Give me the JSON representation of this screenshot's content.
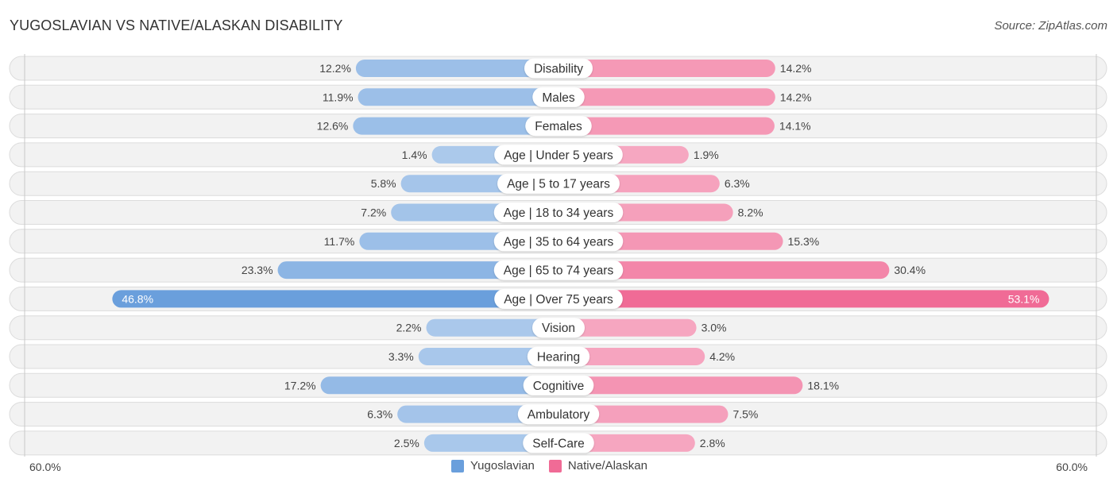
{
  "header": {
    "title": "YUGOSLAVIAN VS NATIVE/ALASKAN DISABILITY",
    "source": "Source: ZipAtlas.com"
  },
  "axis": {
    "left_label": "60.0%",
    "right_label": "60.0%"
  },
  "legend": [
    {
      "name": "Yugoslavian",
      "color": "#6a9fdc"
    },
    {
      "name": "Native/Alaskan",
      "color": "#f06b96"
    }
  ],
  "chart_data": {
    "type": "bar",
    "orientation": "horizontal-diverging",
    "title": "YUGOSLAVIAN VS NATIVE/ALASKAN DISABILITY",
    "xlabel": "",
    "ylabel": "",
    "xlim": [
      -60,
      60
    ],
    "tick_labels": [
      "60.0%",
      "60.0%"
    ],
    "legend_position": "bottom-center",
    "categories": [
      "Disability",
      "Males",
      "Females",
      "Age | Under 5 years",
      "Age | 5 to 17 years",
      "Age | 18 to 34 years",
      "Age | 35 to 64 years",
      "Age | 65 to 74 years",
      "Age | Over 75 years",
      "Vision",
      "Hearing",
      "Cognitive",
      "Ambulatory",
      "Self-Care"
    ],
    "series": [
      {
        "name": "Yugoslavian",
        "color": "#6a9fdc",
        "values": [
          12.2,
          11.9,
          12.6,
          1.4,
          5.8,
          7.2,
          11.7,
          23.3,
          46.8,
          2.2,
          3.3,
          17.2,
          6.3,
          2.5
        ],
        "labels": [
          "12.2%",
          "11.9%",
          "12.6%",
          "1.4%",
          "5.8%",
          "7.2%",
          "11.7%",
          "23.3%",
          "46.8%",
          "2.2%",
          "3.3%",
          "17.2%",
          "6.3%",
          "2.5%"
        ]
      },
      {
        "name": "Native/Alaskan",
        "color": "#f06b96",
        "values": [
          14.2,
          14.2,
          14.1,
          1.9,
          6.3,
          8.2,
          15.3,
          30.4,
          53.1,
          3.0,
          4.2,
          18.1,
          7.5,
          2.8
        ],
        "labels": [
          "14.2%",
          "14.2%",
          "14.1%",
          "1.9%",
          "6.3%",
          "8.2%",
          "15.3%",
          "30.4%",
          "53.1%",
          "3.0%",
          "4.2%",
          "18.1%",
          "7.5%",
          "2.8%"
        ]
      }
    ]
  }
}
